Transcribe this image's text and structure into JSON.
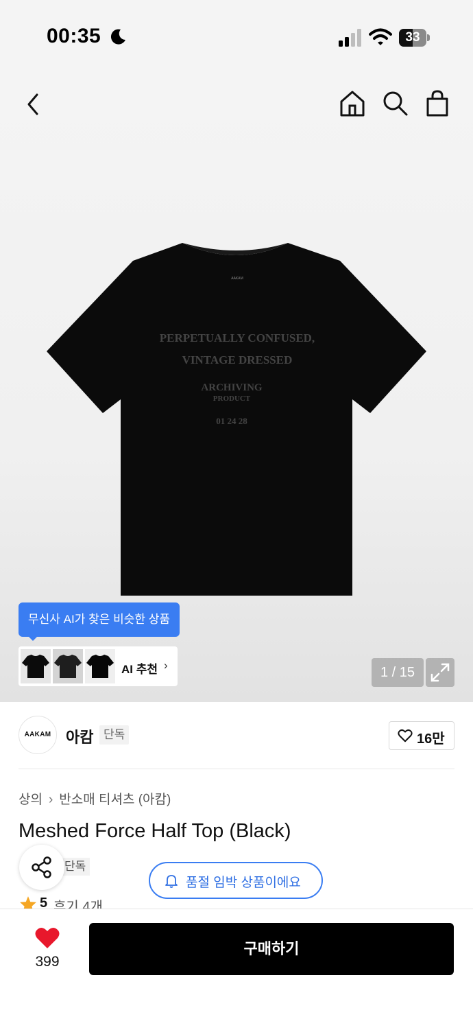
{
  "status_bar": {
    "time": "00:35",
    "battery": "33"
  },
  "product_image": {
    "shirt_print_lines": [
      "PERPETUALLY CONFUSED,",
      "VINTAGE DRESSED",
      "ARCHIVING",
      "PRODUCT",
      "01 24 28"
    ],
    "neck_label": "AAKAM"
  },
  "ai_tooltip": {
    "text": "무신사 AI가 찾은 비슷한 상품"
  },
  "ai_recommend": {
    "label": "AI 추천",
    "chevron": "›"
  },
  "gallery": {
    "counter": "1 / 15"
  },
  "brand": {
    "logo_text": "AAKAM",
    "name": "아캄",
    "badge": "단독",
    "likes": "16만"
  },
  "breadcrumb": {
    "category": "상의",
    "separator": "›",
    "subcategory": "반소매 티셔츠 (아캄)"
  },
  "product": {
    "title": "Meshed Force Half Top (Black)",
    "exclusive_tag": "단독"
  },
  "soldout_notice": {
    "text": "품절 임박 상품이에요"
  },
  "rating": {
    "score": "5",
    "reviews": "후기 4개"
  },
  "bottom_bar": {
    "wish_count": "399",
    "buy_label": "구매하기"
  },
  "colors": {
    "accent_blue": "#3a7df2",
    "wish_red": "#e8182c",
    "star_orange": "#f5a623",
    "buy_black": "#000000"
  }
}
